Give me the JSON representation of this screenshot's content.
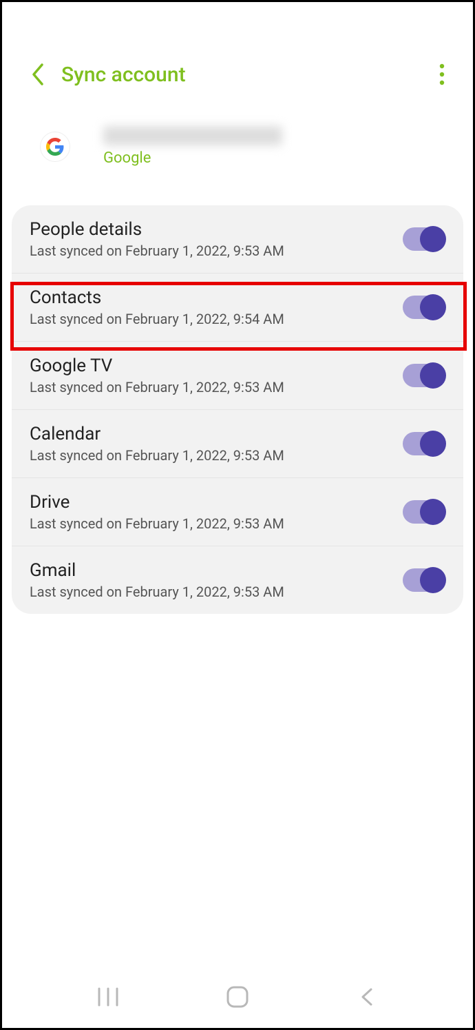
{
  "header": {
    "title": "Sync account"
  },
  "account": {
    "provider": "Google"
  },
  "sync_items": [
    {
      "title": "People details",
      "sub": "Last synced on February 1, 2022, 9:53 AM",
      "on": true
    },
    {
      "title": "Contacts",
      "sub": "Last synced on February 1, 2022, 9:54 AM",
      "on": true
    },
    {
      "title": "Google TV",
      "sub": "Last synced on February 1, 2022, 9:53 AM",
      "on": true
    },
    {
      "title": "Calendar",
      "sub": "Last synced on February 1, 2022, 9:53 AM",
      "on": true
    },
    {
      "title": "Drive",
      "sub": "Last synced on February 1, 2022, 9:53 AM",
      "on": true
    },
    {
      "title": "Gmail",
      "sub": "Last synced on February 1, 2022, 9:53 AM",
      "on": true
    }
  ]
}
